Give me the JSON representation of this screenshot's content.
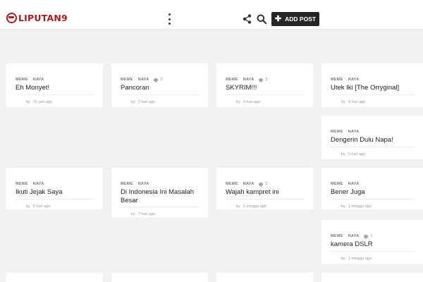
{
  "header": {
    "logo_text": "LIPUTAN9",
    "menu_icon": "kebab-menu-icon",
    "share_icon": "share-icon",
    "search_icon": "search-icon",
    "add_post_label": "ADD POST"
  },
  "cards": [
    {
      "tag1": "MEME",
      "tag2": "NAYA",
      "comments": "",
      "title": "Eh Monyet!",
      "by": "by",
      "time": "21 jam ago"
    },
    {
      "tag1": "MEME",
      "tag2": "NAYA",
      "comments": "2",
      "title": "Pancoran",
      "by": "by",
      "time": "2 hari ago"
    },
    {
      "tag1": "MEME",
      "tag2": "NAYA",
      "comments": "3",
      "title": "SKYRIM!!!",
      "by": "by",
      "time": "3 hari ago"
    },
    {
      "tag1": "MEME",
      "tag2": "NAYA",
      "comments": "",
      "title": "Utek Iki [The Orryginal]",
      "by": "by",
      "time": "4 hari ago"
    },
    {
      "tag1": "MEME",
      "tag2": "NAYA",
      "comments": "",
      "title": "Dengerin Dulu Napa!",
      "by": "by",
      "time": "5 hari ago"
    },
    {
      "tag1": "MEME",
      "tag2": "NAYA",
      "comments": "",
      "title": "Ikuti Jejak Saya",
      "by": "by",
      "time": "6 hari ago"
    },
    {
      "tag1": "MEME",
      "tag2": "NAYA",
      "comments": "",
      "title": "Di Indonesia Ini Masalah Besar",
      "by": "by",
      "time": "7 hari ago"
    },
    {
      "tag1": "MEME",
      "tag2": "NAYA",
      "comments": "2",
      "title": "Wajah kampret ini",
      "by": "by",
      "time": "1 minggu ago"
    },
    {
      "tag1": "MEME",
      "tag2": "NAYA",
      "comments": "",
      "title": "Bener Juga",
      "by": "by",
      "time": "1 minggu ago"
    },
    {
      "tag1": "MEME",
      "tag2": "NAYA",
      "comments": "1",
      "title": "kamera DSLR",
      "by": "by",
      "time": "1 minggu ago"
    }
  ],
  "colors": {
    "brand": "#a31d22",
    "button_bg": "#262626",
    "page_bg": "#f2f2f2"
  }
}
